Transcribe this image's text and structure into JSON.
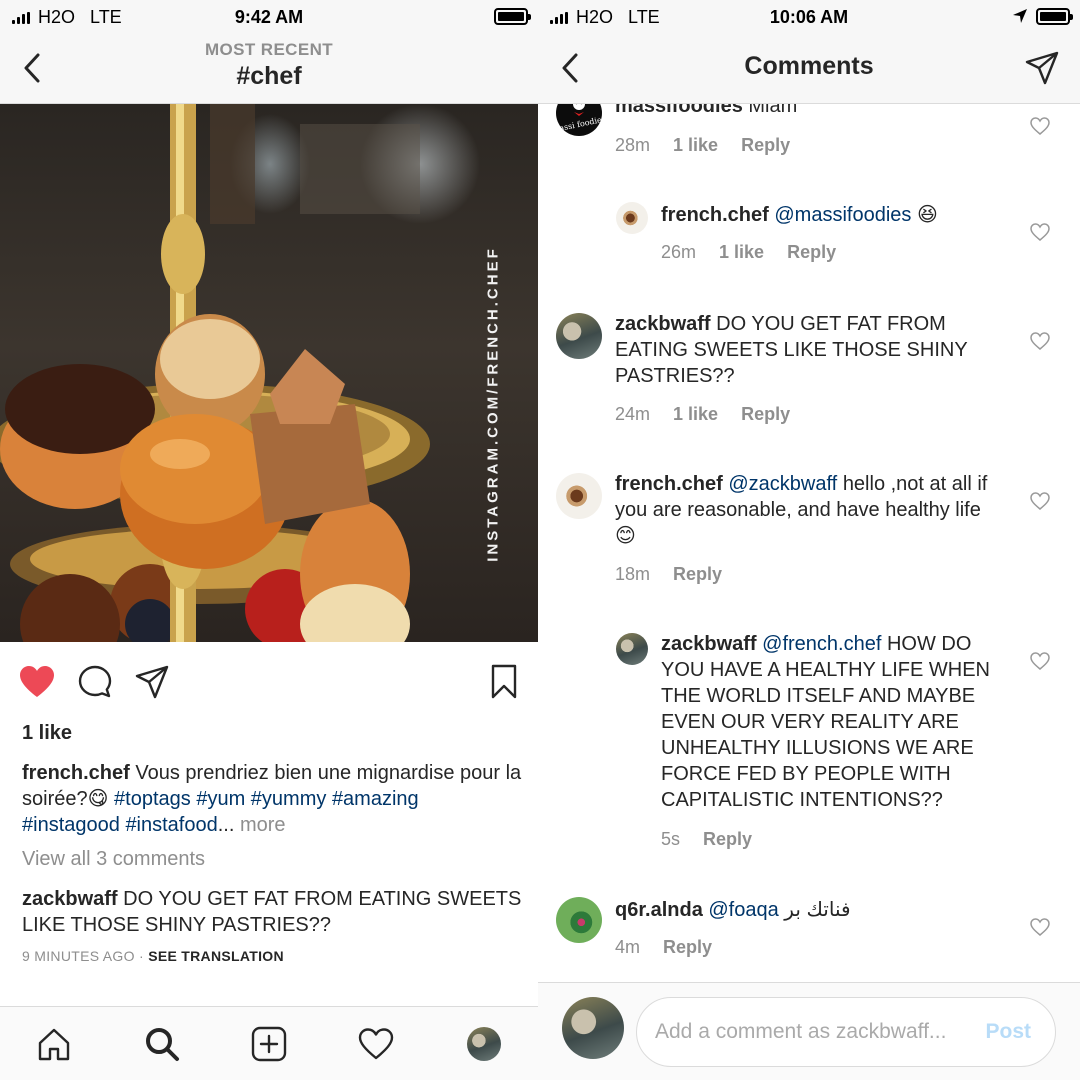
{
  "left": {
    "status": {
      "carrier": "H2O",
      "network": "LTE",
      "time": "9:42 AM"
    },
    "nav": {
      "subtitle": "MOST RECENT",
      "title": "#chef"
    },
    "post": {
      "watermark": "INSTAGRAM.COM/FRENCH.CHEF",
      "liked": true,
      "like_color": "#ed4956",
      "likes": "1 like",
      "caption": {
        "username": "french.chef",
        "text": "Vous prendriez bien une mignardise pour la soirée?",
        "emoji": "😋",
        "hashtags": [
          "#toptags",
          "#yum",
          "#yummy",
          "#amazing",
          "#instagood",
          "#instafood"
        ],
        "ellipsis": "...",
        "more": "more"
      },
      "view_all": "View all 3 comments",
      "top_comment": {
        "username": "zackbwaff",
        "text": "DO YOU GET FAT FROM EATING SWEETS LIKE THOSE SHINY PASTRIES??"
      },
      "time_ago": "9 MINUTES AGO",
      "separator": "·",
      "see_translation": "SEE TRANSLATION"
    },
    "tabbar": [
      "home-icon",
      "search-icon",
      "add-icon",
      "heart-icon",
      "profile-avatar"
    ]
  },
  "right": {
    "status": {
      "carrier": "H2O",
      "network": "LTE",
      "time": "10:06 AM"
    },
    "nav": {
      "title": "Comments"
    },
    "comments": [
      {
        "username": "massifoodies",
        "text": "Miam",
        "time": "28m",
        "likes": "1 like",
        "reply": "Reply"
      },
      {
        "username": "french.chef",
        "mention": "@massifoodies",
        "text": "",
        "emoji": "😆",
        "time": "26m",
        "likes": "1 like",
        "reply": "Reply"
      },
      {
        "username": "zackbwaff",
        "text": "DO YOU GET FAT FROM EATING SWEETS LIKE THOSE SHINY PASTRIES??",
        "time": "24m",
        "likes": "1 like",
        "reply": "Reply"
      },
      {
        "username": "french.chef",
        "mention": "@zackbwaff",
        "text": "hello ,not at all if you are reasonable, and have healthy life",
        "emoji": "😊",
        "time": "18m",
        "reply": "Reply"
      },
      {
        "username": "zackbwaff",
        "mention": "@french.chef",
        "text": "HOW DO YOU HAVE A HEALTHY LIFE WHEN THE WORLD ITSELF AND MAYBE EVEN OUR VERY REALITY ARE UNHEALTHY ILLUSIONS WE ARE FORCE FED BY PEOPLE WITH CAPITALISTIC INTENTIONS??",
        "time": "5s",
        "reply": "Reply"
      },
      {
        "username": "q6r.alnda",
        "mention": "@foaqa",
        "text": "فناتك بر",
        "time": "4m",
        "reply": "Reply"
      }
    ],
    "massi_logo_text": "Massi foodies",
    "input": {
      "placeholder": "Add a comment as zackbwaff...",
      "post": "Post"
    }
  }
}
